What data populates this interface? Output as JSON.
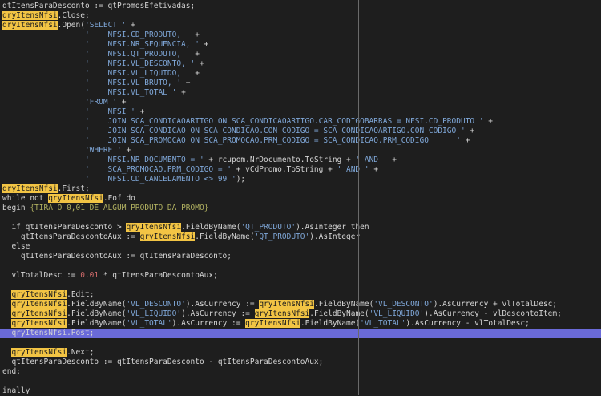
{
  "editor": {
    "language": "delphi",
    "highlighted_identifier": "qryItensNfsi",
    "current_line_index": 34,
    "colors": {
      "background": "#1e1e1e",
      "text": "#d4d4d4",
      "string": "#7fa7d8",
      "number": "#d06a6a",
      "comment": "#b0b060",
      "highlight": "#f2c444",
      "current_line": "#6a6ad8",
      "margin": "#6a6a6a"
    },
    "lines": [
      [
        {
          "t": "qtItensParaDesconto := qtPromosEfetivadas;",
          "k": "id"
        }
      ],
      [
        {
          "t": "qryItensNfsi",
          "k": "hl"
        },
        {
          "t": ".Close;",
          "k": "id"
        }
      ],
      [
        {
          "t": "qryItensNfsi",
          "k": "hl"
        },
        {
          "t": ".Open(",
          "k": "id"
        },
        {
          "t": "'SELECT '",
          "k": "str"
        },
        {
          "t": " +",
          "k": "id"
        }
      ],
      [
        {
          "t": "                  ",
          "k": "id"
        },
        {
          "t": "'    NFSI.CD_PRODUTO, '",
          "k": "str"
        },
        {
          "t": " +",
          "k": "id"
        }
      ],
      [
        {
          "t": "                  ",
          "k": "id"
        },
        {
          "t": "'    NFSI.NR_SEQUENCIA, '",
          "k": "str"
        },
        {
          "t": " +",
          "k": "id"
        }
      ],
      [
        {
          "t": "                  ",
          "k": "id"
        },
        {
          "t": "'    NFSI.QT_PRODUTO, '",
          "k": "str"
        },
        {
          "t": " +",
          "k": "id"
        }
      ],
      [
        {
          "t": "                  ",
          "k": "id"
        },
        {
          "t": "'    NFSI.VL_DESCONTO, '",
          "k": "str"
        },
        {
          "t": " +",
          "k": "id"
        }
      ],
      [
        {
          "t": "                  ",
          "k": "id"
        },
        {
          "t": "'    NFSI.VL_LIQUIDO, '",
          "k": "str"
        },
        {
          "t": " +",
          "k": "id"
        }
      ],
      [
        {
          "t": "                  ",
          "k": "id"
        },
        {
          "t": "'    NFSI.VL_BRUTO, '",
          "k": "str"
        },
        {
          "t": " +",
          "k": "id"
        }
      ],
      [
        {
          "t": "                  ",
          "k": "id"
        },
        {
          "t": "'    NFSI.VL_TOTAL '",
          "k": "str"
        },
        {
          "t": " +",
          "k": "id"
        }
      ],
      [
        {
          "t": "                  ",
          "k": "id"
        },
        {
          "t": "'FROM '",
          "k": "str"
        },
        {
          "t": " +",
          "k": "id"
        }
      ],
      [
        {
          "t": "                  ",
          "k": "id"
        },
        {
          "t": "'    NFSI '",
          "k": "str"
        },
        {
          "t": " +",
          "k": "id"
        }
      ],
      [
        {
          "t": "                  ",
          "k": "id"
        },
        {
          "t": "'    JOIN SCA_CONDICAOARTIGO ON SCA_CONDICAOARTIGO.CAR_CODIGOBARRAS = NFSI.CD_PRODUTO '",
          "k": "str"
        },
        {
          "t": " +",
          "k": "id"
        }
      ],
      [
        {
          "t": "                  ",
          "k": "id"
        },
        {
          "t": "'    JOIN SCA_CONDICAO ON SCA_CONDICAO.CON_CODIGO = SCA_CONDICAOARTIGO.CON_CODIGO '",
          "k": "str"
        },
        {
          "t": " +",
          "k": "id"
        }
      ],
      [
        {
          "t": "                  ",
          "k": "id"
        },
        {
          "t": "'    JOIN SCA_PROMOCAO ON SCA_PROMOCAO.PRM_CODIGO = SCA_CONDICAO.PRM_CODIGO      '",
          "k": "str"
        },
        {
          "t": " +",
          "k": "id"
        }
      ],
      [
        {
          "t": "                  ",
          "k": "id"
        },
        {
          "t": "'WHERE '",
          "k": "str"
        },
        {
          "t": " +",
          "k": "id"
        }
      ],
      [
        {
          "t": "                  ",
          "k": "id"
        },
        {
          "t": "'    NFSI.NR_DOCUMENTO = '",
          "k": "str"
        },
        {
          "t": " + rcupom.NrDocumento.ToString + ",
          "k": "id"
        },
        {
          "t": "' AND '",
          "k": "str"
        },
        {
          "t": " +",
          "k": "id"
        }
      ],
      [
        {
          "t": "                  ",
          "k": "id"
        },
        {
          "t": "'    SCA_PROMOCAO.PRM_CODIGO = '",
          "k": "str"
        },
        {
          "t": " + vCdPromo.ToString + ",
          "k": "id"
        },
        {
          "t": "' AND '",
          "k": "str"
        },
        {
          "t": " +",
          "k": "id"
        }
      ],
      [
        {
          "t": "                  ",
          "k": "id"
        },
        {
          "t": "'    NFSI.CD_CANCELAMENTO <> 99 '",
          "k": "str"
        },
        {
          "t": ");",
          "k": "id"
        }
      ],
      [
        {
          "t": "qryItensNfsi",
          "k": "hl"
        },
        {
          "t": ".First;",
          "k": "id"
        }
      ],
      [
        {
          "t": "while not ",
          "k": "kw"
        },
        {
          "t": "qryItensNfsi",
          "k": "hl"
        },
        {
          "t": ".Eof do",
          "k": "id"
        }
      ],
      [
        {
          "t": "begin ",
          "k": "kw"
        },
        {
          "t": "{TIRA O 0,01 DE ALGUM PRODUTO DA PROMO}",
          "k": "comment"
        }
      ],
      [
        {
          "t": "",
          "k": "id"
        }
      ],
      [
        {
          "t": "  if qtItensParaDesconto > ",
          "k": "id"
        },
        {
          "t": "qryItensNfsi",
          "k": "hl"
        },
        {
          "t": ".FieldByName(",
          "k": "id"
        },
        {
          "t": "'QT_PRODUTO'",
          "k": "str"
        },
        {
          "t": ").AsInteger then",
          "k": "id"
        }
      ],
      [
        {
          "t": "    qtItensParaDescontoAux := ",
          "k": "id"
        },
        {
          "t": "qryItensNfsi",
          "k": "hl"
        },
        {
          "t": ".FieldByName(",
          "k": "id"
        },
        {
          "t": "'QT_PRODUTO'",
          "k": "str"
        },
        {
          "t": ").AsInteger",
          "k": "id"
        }
      ],
      [
        {
          "t": "  else",
          "k": "kw"
        }
      ],
      [
        {
          "t": "    qtItensParaDescontoAux := qtItensParaDesconto;",
          "k": "id"
        }
      ],
      [
        {
          "t": "",
          "k": "id"
        }
      ],
      [
        {
          "t": "  vlTotalDesc := ",
          "k": "id"
        },
        {
          "t": "0.01",
          "k": "num"
        },
        {
          "t": " * qtItensParaDescontoAux;",
          "k": "id"
        }
      ],
      [
        {
          "t": "",
          "k": "id"
        }
      ],
      [
        {
          "t": "  ",
          "k": "id"
        },
        {
          "t": "qryItensNfsi",
          "k": "hl"
        },
        {
          "t": ".Edit;",
          "k": "id"
        }
      ],
      [
        {
          "t": "  ",
          "k": "id"
        },
        {
          "t": "qryItensNfsi",
          "k": "hl"
        },
        {
          "t": ".FieldByName(",
          "k": "id"
        },
        {
          "t": "'VL_DESCONTO'",
          "k": "str"
        },
        {
          "t": ").AsCurrency := ",
          "k": "id"
        },
        {
          "t": "qryItensNfsi",
          "k": "hl"
        },
        {
          "t": ".FieldByName(",
          "k": "id"
        },
        {
          "t": "'VL_DESCONTO'",
          "k": "str"
        },
        {
          "t": ").AsCurrency + vlTotalDesc;",
          "k": "id"
        }
      ],
      [
        {
          "t": "  ",
          "k": "id"
        },
        {
          "t": "qryItensNfsi",
          "k": "hl"
        },
        {
          "t": ".FieldByName(",
          "k": "id"
        },
        {
          "t": "'VL_LIQUIDO'",
          "k": "str"
        },
        {
          "t": ").AsCurrency := ",
          "k": "id"
        },
        {
          "t": "qryItensNfsi",
          "k": "hl"
        },
        {
          "t": ".FieldByName(",
          "k": "id"
        },
        {
          "t": "'VL_LIQUIDO'",
          "k": "str"
        },
        {
          "t": ").AsCurrency - vlDescontoItem;",
          "k": "id"
        }
      ],
      [
        {
          "t": "  ",
          "k": "id"
        },
        {
          "t": "qryItensNfsi",
          "k": "hl"
        },
        {
          "t": ".FieldByName(",
          "k": "id"
        },
        {
          "t": "'VL_TOTAL'",
          "k": "str"
        },
        {
          "t": ").AsCurrency := ",
          "k": "id"
        },
        {
          "t": "qryItensNfsi",
          "k": "hl"
        },
        {
          "t": ".FieldByName(",
          "k": "id"
        },
        {
          "t": "'VL_TOTAL'",
          "k": "str"
        },
        {
          "t": ").AsCurrency - vlTotalDesc;",
          "k": "id"
        }
      ],
      [
        {
          "t": "  qryItensNfsi.Post;",
          "k": "id"
        }
      ],
      [
        {
          "t": "",
          "k": "id"
        }
      ],
      [
        {
          "t": "  ",
          "k": "id"
        },
        {
          "t": "qryItensNfsi",
          "k": "hl"
        },
        {
          "t": ".Next;",
          "k": "id"
        }
      ],
      [
        {
          "t": "  qtItensParaDesconto := qtItensParaDesconto - qtItensParaDescontoAux;",
          "k": "id"
        }
      ],
      [
        {
          "t": "end;",
          "k": "kw"
        }
      ],
      [
        {
          "t": "",
          "k": "id"
        }
      ],
      [
        {
          "t": "inally",
          "k": "kw"
        }
      ]
    ]
  }
}
